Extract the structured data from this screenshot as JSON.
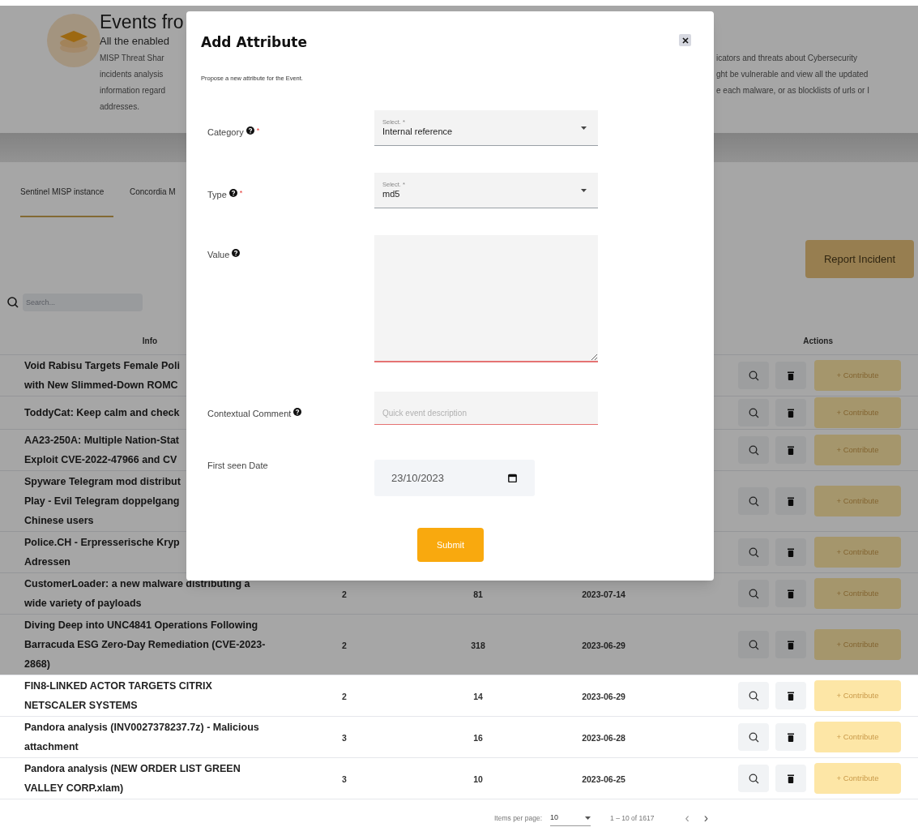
{
  "header": {
    "title": "Events fro",
    "description": [
      {
        "left": "All the enabled",
        "lead": true
      },
      {
        "left": "MISP Threat Shar",
        "right": "icators and threats about Cybersecurity"
      },
      {
        "left": "incidents analysis",
        "right": "ght be vulnerable and view all the updated"
      },
      {
        "left": "information regard",
        "right": "e each malware, or as blocklists of urls or I"
      },
      {
        "left": "addresses."
      }
    ]
  },
  "tabs": [
    {
      "label": "Sentinel MISP instance",
      "selected": true
    },
    {
      "label": "Concordia M",
      "selected": false
    }
  ],
  "report_button": "Report Incident",
  "search": {
    "placeholder": "Search..."
  },
  "table": {
    "columns": [
      "Info",
      "Actions"
    ],
    "rows": [
      {
        "info_lines": [
          "Void Rabisu Targets Female Poli",
          "with New Slimmed-Down ROMC"
        ],
        "action": "+ Contribute"
      },
      {
        "info_lines": [
          "ToddyCat: Keep calm and check"
        ],
        "action": "+ Contribute"
      },
      {
        "info_lines": [
          "AA23-250A: Multiple Nation-Stat",
          "Exploit CVE-2022-47966 and CV"
        ],
        "action": "+ Contribute"
      },
      {
        "info_lines": [
          "Spyware Telegram mod distribut",
          "Play - Evil Telegram doppelgang",
          "Chinese users"
        ],
        "action": "+ Contribute"
      },
      {
        "info_lines": [
          "Police.CH - Erpresserische Kryp",
          "Adressen"
        ],
        "action": "+ Contribute"
      },
      {
        "info": "CustomerLoader: a new malware distributing a wide variety of payloads",
        "column_2": "2",
        "column_3": "81",
        "column_4": "2023-07-14",
        "action": "+ Contribute"
      },
      {
        "info": "Diving Deep into UNC4841 Operations Following Barracuda ESG Zero-Day Remediation (CVE-2023-2868)",
        "column_2": "2",
        "column_3": "318",
        "column_4": "2023-06-29",
        "action": "+ Contribute"
      },
      {
        "info": "FIN8-LINKED ACTOR TARGETS CITRIX NETSCALER SYSTEMS",
        "column_2": "2",
        "column_3": "14",
        "column_4": "2023-06-29",
        "action": "+ Contribute"
      },
      {
        "info": "Pandora analysis (INV0027378237.7z) - Malicious attachment",
        "column_2": "3",
        "column_3": "16",
        "column_4": "2023-06-28",
        "action": "+ Contribute"
      },
      {
        "info": "Pandora analysis (NEW ORDER LIST GREEN VALLEY CORP.xlam)",
        "column_2": "3",
        "column_3": "10",
        "column_4": "2023-06-25",
        "action": "+ Contribute"
      }
    ]
  },
  "pagination": {
    "label": "Items per page:",
    "page_size": "10",
    "range": "1 – 10 of 1617",
    "prev": "‹",
    "next": "›"
  },
  "modal": {
    "title": "Add Attribute",
    "subtitle": "Propose a new attribute for the Event.",
    "fields": [
      {
        "kind": "select",
        "label": "Category",
        "help": true,
        "required_mark": "*",
        "floating_label": "Select. *",
        "value": "Internal reference"
      },
      {
        "kind": "select",
        "label": "Type",
        "help": true,
        "required_mark": "*",
        "floating_label": "Select. *",
        "value": "md5"
      },
      {
        "kind": "textarea",
        "label": "Value",
        "help": true,
        "invalid": true
      },
      {
        "kind": "text",
        "label": "Contextual Comment",
        "help": true,
        "placeholder": "Quick event description",
        "invalid": true
      },
      {
        "kind": "date",
        "label": "First seen Date",
        "help": false,
        "value": "23/10/2023"
      }
    ],
    "submit": "Submit"
  }
}
